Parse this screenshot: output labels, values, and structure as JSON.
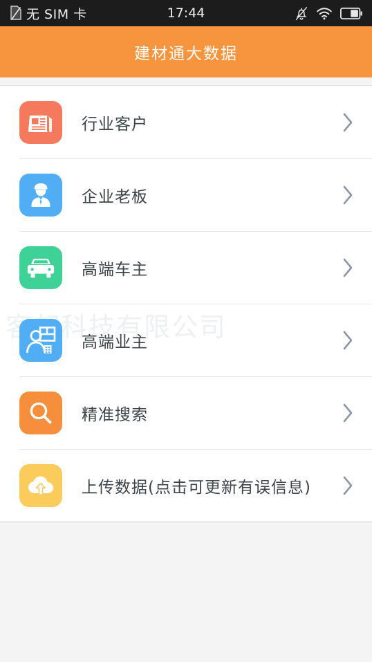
{
  "status_bar": {
    "sim_text": "无 SIM 卡",
    "time": "17:44",
    "icons": [
      "no-sim-icon",
      "silent-bell-icon",
      "wifi-icon",
      "battery-icon"
    ],
    "battery_level_percent": 50
  },
  "header": {
    "title": "建材通大数据",
    "background_color": "#f7943e",
    "title_color": "#ffffff"
  },
  "watermark": {
    "text": "客邦科技有限公司",
    "color": "#eef1f4"
  },
  "list": {
    "items": [
      {
        "label": "行业客户",
        "icon": "newspaper-icon",
        "icon_bg": "#f4795d",
        "chevron": "chevron-right-icon"
      },
      {
        "label": "企业老板",
        "icon": "businessman-icon",
        "icon_bg": "#51aef4",
        "chevron": "chevron-right-icon"
      },
      {
        "label": "高端车主",
        "icon": "car-icon",
        "icon_bg": "#3fd296",
        "chevron": "chevron-right-icon"
      },
      {
        "label": "高端业主",
        "icon": "person-building-icon",
        "icon_bg": "#51aef4",
        "chevron": "chevron-right-icon"
      },
      {
        "label": "精准搜索",
        "icon": "search-icon",
        "icon_bg": "#f58f3c",
        "chevron": "chevron-right-icon"
      },
      {
        "label": "上传数据(点击可更新有误信息)",
        "icon": "cloud-upload-icon",
        "icon_bg": "#fbcb5c",
        "chevron": "chevron-right-icon"
      }
    ]
  },
  "colors": {
    "chevron": "#8b97a3",
    "divider": "#e6e6e6",
    "page_bg": "#f4f4f4",
    "row_text": "#3d4449"
  }
}
